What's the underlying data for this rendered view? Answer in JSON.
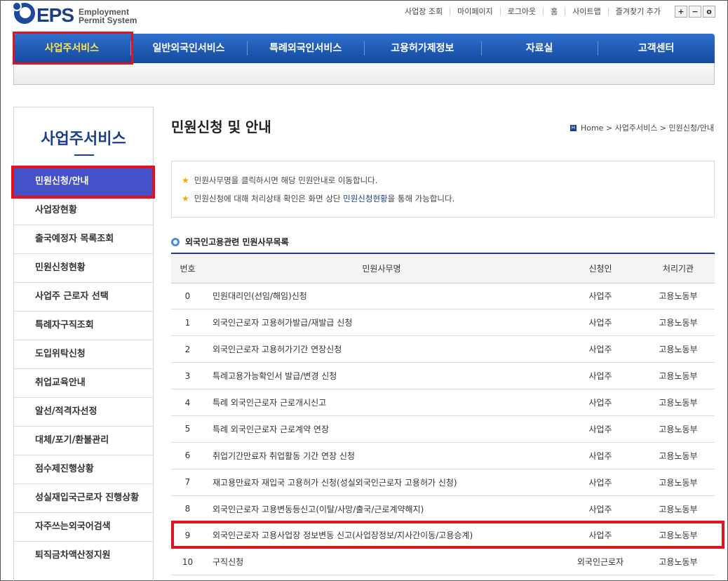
{
  "logo": {
    "mark": "EPS",
    "sub1": "Employment",
    "sub2": "Permit System",
    "icon": "eps-globe-logo"
  },
  "top_links": [
    "사업장 조회",
    "마이페이지",
    "로그아웃",
    "홈",
    "사이트맵",
    "즐겨찾기 추가"
  ],
  "zoom": {
    "plus": "+",
    "minus": "−",
    "reset": "o"
  },
  "gnb": [
    "사업주서비스",
    "일반외국인서비스",
    "특례외국인서비스",
    "고용허가제정보",
    "자료실",
    "고객센터"
  ],
  "lnb": {
    "title": "사업주서비스",
    "items": [
      "민원신청/안내",
      "사업장현황",
      "출국예정자 목록조회",
      "민원신청현황",
      "사업주 근로자 선택",
      "특례자구직조회",
      "도입위탁신청",
      "취업교육안내",
      "알선/적격자선정",
      "대체/포기/환불관리",
      "점수제진행상황",
      "성실재입국근로자 진행상황",
      "자주쓰는외국어검색",
      "퇴직금차액산정지원"
    ]
  },
  "page": {
    "title": "민원신청 및 안내",
    "breadcrumb_icon": "H",
    "breadcrumb": "Home > 사업주서비스 > 민원신청/안내"
  },
  "notice": {
    "line1": "민원사무명을 클릭하시면 해당 민원안내로 이동합니다.",
    "line2_pre": "민원신청에 대해 처리상태 확인은 화면 상단 ",
    "line2_link": "민원신청현황",
    "line2_post": "을 통해 가능합니다."
  },
  "section": {
    "title": "외국인고용관련 민원사무목록"
  },
  "table": {
    "headers": {
      "no": "번호",
      "name": "민원사무명",
      "applicant": "신청인",
      "org": "처리기관"
    },
    "rows": [
      {
        "no": "0",
        "name": "민원대리인(선임/해임)신청",
        "applicant": "사업주",
        "org": "고용노동부"
      },
      {
        "no": "1",
        "name": "외국인근로자 고용허가발급/재발급 신청",
        "applicant": "사업주",
        "org": "고용노동부"
      },
      {
        "no": "2",
        "name": "외국인근로자 고용허가기간 연장신청",
        "applicant": "사업주",
        "org": "고용노동부"
      },
      {
        "no": "3",
        "name": "특례고용가능확인서 발급/변경 신청",
        "applicant": "사업주",
        "org": "고용노동부"
      },
      {
        "no": "4",
        "name": "특례 외국인근로자 근로개시신고",
        "applicant": "사업주",
        "org": "고용노동부"
      },
      {
        "no": "5",
        "name": "특례 외국인근로자 근로계약 연장",
        "applicant": "사업주",
        "org": "고용노동부"
      },
      {
        "no": "6",
        "name": "취업기간만료자 취업활동 기간 연장 신청",
        "applicant": "사업주",
        "org": "고용노동부"
      },
      {
        "no": "7",
        "name": "재고용만료자 재입국 고용허가 신청(성실외국인근로자 고용허가 신청)",
        "applicant": "사업주",
        "org": "고용노동부"
      },
      {
        "no": "8",
        "name": "외국인근로자 고용변동등신고(이탈/사망/출국/근로계약해지)",
        "applicant": "사업주",
        "org": "고용노동부"
      },
      {
        "no": "9",
        "name": "외국인근로자 고용사업장 정보변동 신고(사업장정보/지사간이동/고용승계)",
        "applicant": "사업주",
        "org": "고용노동부"
      },
      {
        "no": "10",
        "name": "구직신청",
        "applicant": "외국인근로자",
        "org": "고용노동부"
      }
    ]
  }
}
